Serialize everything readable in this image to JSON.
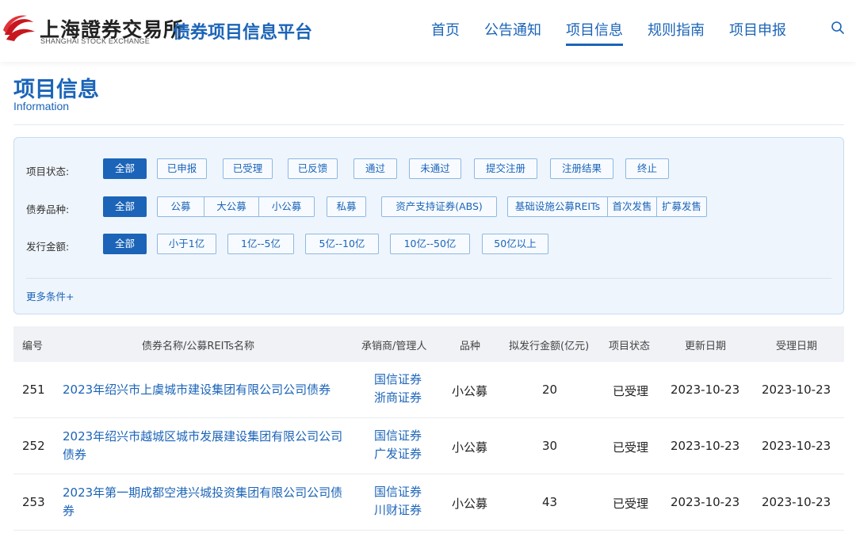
{
  "header": {
    "logo_cn": "上海證券交易所",
    "logo_en": "SHANGHAI STOCK EXCHANGE",
    "platform": "债券项目信息平台",
    "nav": [
      "首页",
      "公告通知",
      "项目信息",
      "规则指南",
      "项目申报"
    ],
    "active_nav": "项目信息"
  },
  "page": {
    "title": "项目信息",
    "subtitle": "Information"
  },
  "filters": {
    "status": {
      "label": "项目状态:",
      "options": [
        "全部",
        "已申报",
        "已受理",
        "已反馈",
        "通过",
        "未通过",
        "提交注册",
        "注册结果",
        "终止"
      ]
    },
    "type": {
      "label": "债券品种:",
      "options": [
        "全部",
        "公募",
        "大公募",
        "小公募",
        "私募",
        "资产支持证券(ABS)",
        "基础设施公募REITs",
        "首次发售",
        "扩募发售"
      ]
    },
    "amount": {
      "label": "发行金额:",
      "options": [
        "全部",
        "小于1亿",
        "1亿--5亿",
        "5亿--10亿",
        "10亿--50亿",
        "50亿以上"
      ]
    },
    "more": "更多条件+"
  },
  "table": {
    "headers": [
      "编号",
      "债券名称/公募REITs名称",
      "承销商/管理人",
      "品种",
      "拟发行金额(亿元)",
      "项目状态",
      "更新日期",
      "受理日期"
    ],
    "rows": [
      {
        "id": "251",
        "name": "2023年绍兴市上虞城市建设集团有限公司公司债券",
        "underwriters": [
          "国信证券",
          "浙商证券"
        ],
        "type": "小公募",
        "amount": "20",
        "status": "已受理",
        "updated": "2023-10-23",
        "accepted": "2023-10-23"
      },
      {
        "id": "252",
        "name": "2023年绍兴市越城区城市发展建设集团有限公司公司债券",
        "underwriters": [
          "国信证券",
          "广发证券"
        ],
        "type": "小公募",
        "amount": "30",
        "status": "已受理",
        "updated": "2023-10-23",
        "accepted": "2023-10-23"
      },
      {
        "id": "253",
        "name": "2023年第一期成都空港兴城投资集团有限公司公司债券",
        "underwriters": [
          "国信证券",
          "川财证券"
        ],
        "type": "小公募",
        "amount": "43",
        "status": "已受理",
        "updated": "2023-10-23",
        "accepted": "2023-10-23"
      }
    ]
  },
  "icons": {
    "logo": "sse-logo-icon",
    "search": "search-icon"
  },
  "colors": {
    "brand": "#1b64b8",
    "panel_bg": "#eef5fc",
    "header_row_bg": "#f0f2f5"
  }
}
